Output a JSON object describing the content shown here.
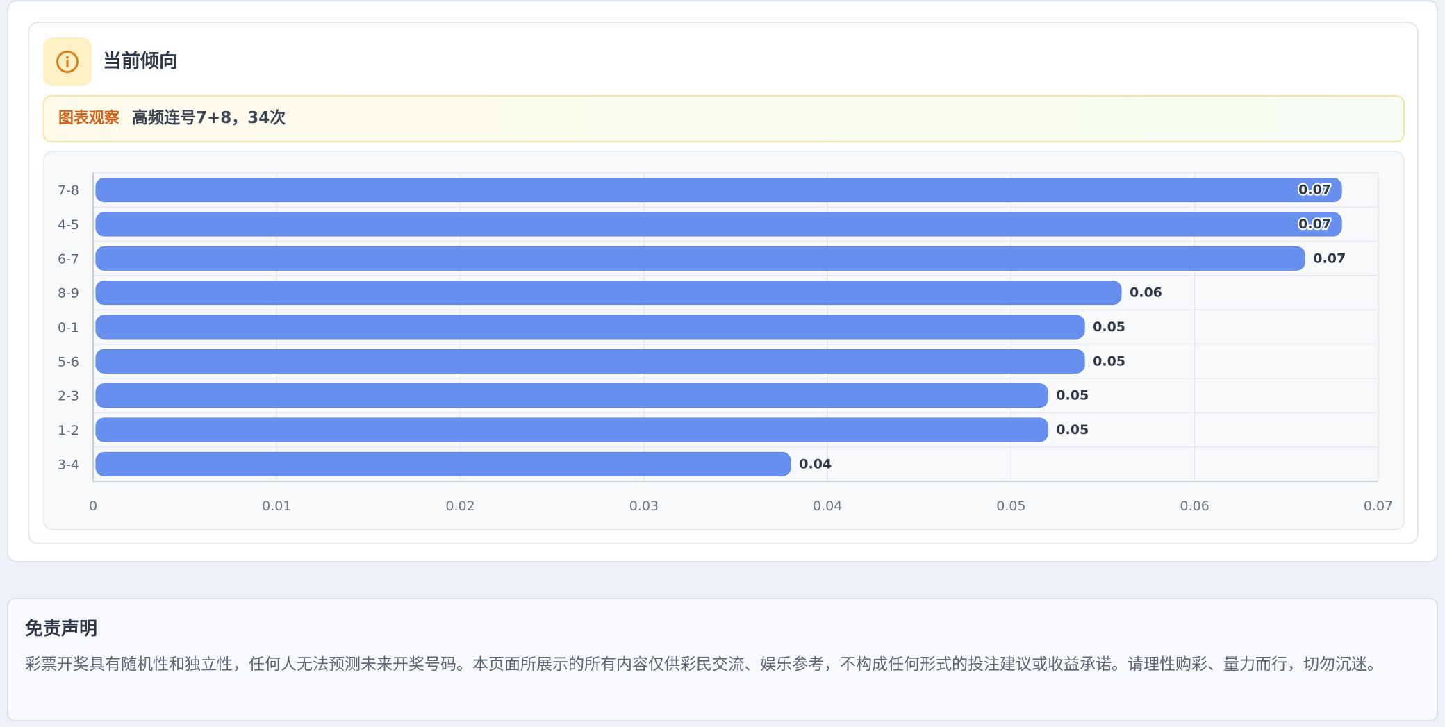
{
  "panel": {
    "title": "当前倾向",
    "icon": "info-icon",
    "observation_label": "图表观察",
    "observation_text": "高频连号7+8，34次"
  },
  "chart_data": {
    "type": "bar",
    "orientation": "horizontal",
    "categories": [
      "7-8",
      "4-5",
      "6-7",
      "8-9",
      "0-1",
      "5-6",
      "2-3",
      "1-2",
      "3-4"
    ],
    "values": [
      0.068,
      0.068,
      0.066,
      0.056,
      0.054,
      0.054,
      0.052,
      0.052,
      0.038
    ],
    "value_labels": [
      "0.07",
      "0.07",
      "0.07",
      "0.06",
      "0.05",
      "0.05",
      "0.05",
      "0.05",
      "0.04"
    ],
    "x_ticks": [
      "0",
      "0.01",
      "0.02",
      "0.03",
      "0.04",
      "0.05",
      "0.06",
      "0.07"
    ],
    "xlim": [
      0,
      0.07
    ],
    "grid": true,
    "bar_color": "#6891ef"
  },
  "disclaimer": {
    "title": "免责声明",
    "text": "彩票开奖具有随机性和独立性，任何人无法预测未来开奖号码。本页面所展示的所有内容仅供彩民交流、娱乐参考，不构成任何形式的投注建议或收益承诺。请理性购彩、量力而行，切勿沉迷。"
  },
  "colors": {
    "accent_orange": "#d0621b",
    "icon_bg": "#fdf0c5",
    "bar": "#6891ef"
  }
}
